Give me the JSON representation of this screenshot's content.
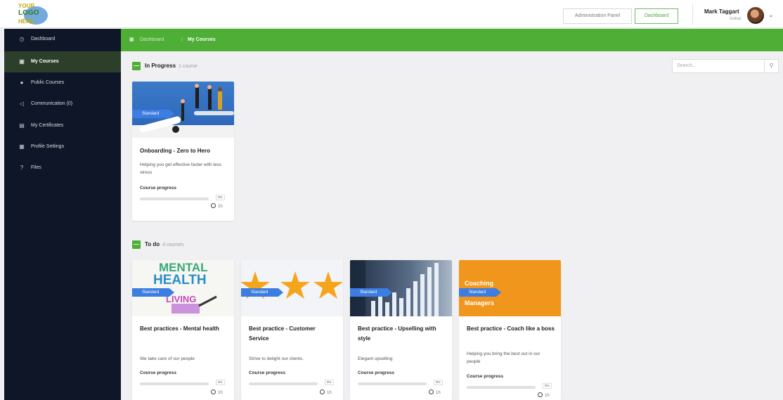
{
  "header": {
    "logo_text": [
      "YOUR",
      "LOGO",
      "HERE"
    ],
    "admin_panel_label": "Administration Panel",
    "dashboard_label": "Dashboard",
    "user_name": "Mark Taggart",
    "user_role": "Isobar"
  },
  "sidebar": {
    "items": [
      {
        "icon": "dashboard-icon",
        "label": "Dashboard",
        "active": false
      },
      {
        "icon": "book-icon",
        "label": "My Courses",
        "active": true
      },
      {
        "icon": "globe-icon",
        "label": "Public Courses",
        "active": false
      },
      {
        "icon": "megaphone-icon",
        "label": "Communication (0)",
        "active": false
      },
      {
        "icon": "certificate-icon",
        "label": "My Certificates",
        "active": false
      },
      {
        "icon": "profile-card-icon",
        "label": "Profile Settings",
        "active": false
      },
      {
        "icon": "help-icon",
        "label": "Files",
        "active": false
      }
    ]
  },
  "breadcrumb": {
    "items": [
      "Dashboard",
      "My Courses"
    ],
    "separator": "/"
  },
  "search": {
    "placeholder": "Search..."
  },
  "sections": {
    "in_progress": {
      "title": "In Progress",
      "count": "1 course",
      "toggle": "—"
    },
    "todo": {
      "title": "To do",
      "count": "4 courses",
      "toggle": "—"
    }
  },
  "courses": [
    {
      "section": "in_progress",
      "badge": "Standard",
      "title": "Onboarding - Zero to Hero",
      "desc": "Helping you get effective faster with less stress",
      "progress_label": "Course progress",
      "progress": 0,
      "progress_text": "0%",
      "duration": "1h"
    },
    {
      "section": "todo",
      "badge": "Standard",
      "title": "Best practices - Mental health",
      "desc": "We take care of our people",
      "progress_label": "Course progress",
      "progress": 0,
      "progress_text": "0%",
      "duration": "1h",
      "art_words": [
        "MENTAL",
        "HEALTH",
        "LIVING"
      ]
    },
    {
      "section": "todo",
      "badge": "Standard",
      "title": "Best practice - Customer Service",
      "desc": "Strive to delight our clients.",
      "progress_label": "Course progress",
      "progress": 0,
      "progress_text": "0%",
      "duration": "1h"
    },
    {
      "section": "todo",
      "badge": "Standard",
      "title": "Best practice - Upselling with style",
      "desc": "Elegant upselling",
      "progress_label": "Course progress",
      "progress": 0,
      "progress_text": "0%",
      "duration": "1h"
    },
    {
      "section": "todo",
      "badge": "Standard",
      "title": "Best practice - Coach like a boss",
      "desc": "Helping you bring the best out in our people",
      "progress_label": "Course progress",
      "progress": 0,
      "progress_text": "0%",
      "duration": "1h",
      "art_words": [
        "Coaching",
        "Managers"
      ]
    }
  ],
  "colors": {
    "brand_green": "#4eae35",
    "sidebar_bg": "#0f1627",
    "badge_blue": "#3b7de0",
    "coaching_orange": "#f0961c"
  }
}
